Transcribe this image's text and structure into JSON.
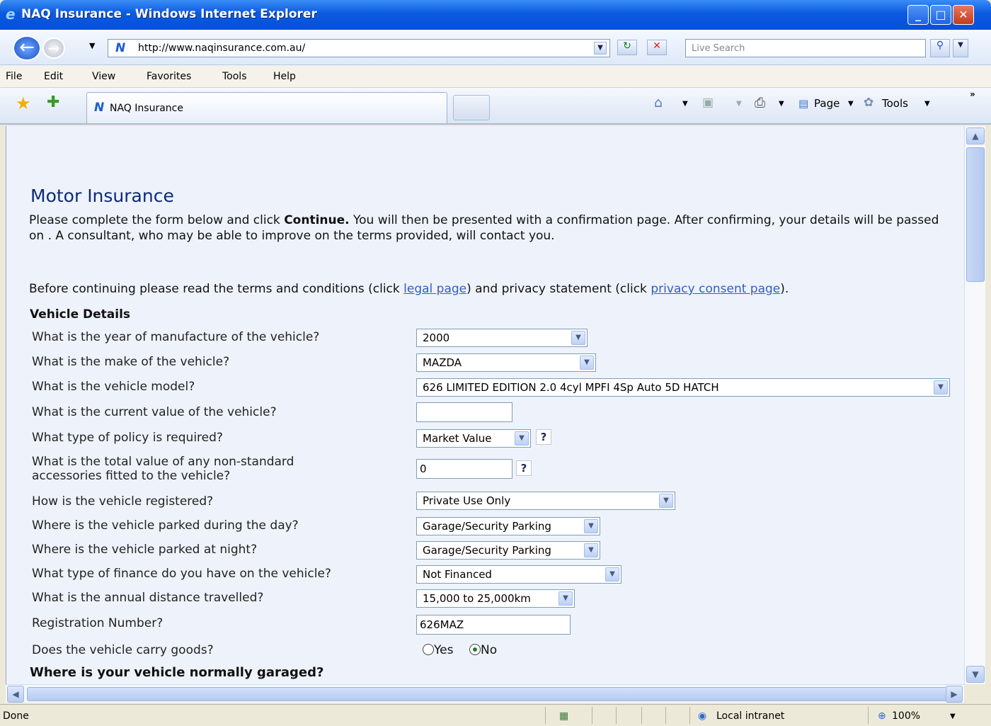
{
  "window": {
    "title": "NAQ Insurance - Windows Internet Explorer",
    "minimize": "_",
    "maximize": "□",
    "close": "✕"
  },
  "nav": {
    "url": "http://www.naqinsurance.com.au/",
    "search_placeholder": "Live Search"
  },
  "menu": [
    "File",
    "Edit",
    "View",
    "Favorites",
    "Tools",
    "Help"
  ],
  "tab": {
    "label": "NAQ Insurance"
  },
  "toolbar": {
    "page_label": "Page",
    "tools_label": "Tools"
  },
  "page": {
    "heading": "Motor Insurance",
    "intro_a": "Please complete the form below and click ",
    "intro_bold": "Continue.",
    "intro_b": " You will then be presented with a confirmation page. After confirming, your details will be passed on . A consultant, who may be able to improve on the terms provided, will contact you.",
    "terms_a": "Before continuing please read the terms and conditions (click ",
    "legal_link": "legal page",
    "terms_b": ") and privacy statement (click ",
    "privacy_link": "privacy consent page",
    "terms_c": ").",
    "section_vehicle": "Vehicle Details",
    "section_garage": "Where is your vehicle normally garaged?"
  },
  "form": {
    "q_year": "What is the year of manufacture of the vehicle?",
    "v_year": "2000",
    "q_make": "What is the make of the vehicle?",
    "v_make": "MAZDA",
    "q_model": "What is the vehicle model?",
    "v_model": "626 LIMITED EDITION 2.0 4cyl MPFI 4Sp Auto 5D HATCH",
    "q_value": "What is the current value of the vehicle?",
    "v_value": "",
    "q_policy": "What type of policy is required?",
    "v_policy": "Market Value",
    "q_accessories": "What is the total value of any non-standard accessories fitted to the vehicle?",
    "v_accessories": "0",
    "q_registered": "How is the vehicle registered?",
    "v_registered": "Private Use Only",
    "q_day": "Where is the vehicle parked during the day?",
    "v_day": "Garage/Security Parking",
    "q_night": "Where is the vehicle parked at night?",
    "v_night": "Garage/Security Parking",
    "q_finance": "What type of finance do you have on the vehicle?",
    "v_finance": "Not Financed",
    "q_distance": "What is the annual distance travelled?",
    "v_distance": "15,000 to 25,000km",
    "q_rego": "Registration Number?",
    "v_rego": "626MAZ",
    "q_goods": "Does the vehicle carry goods?",
    "opt_yes": "Yes",
    "opt_no": "No",
    "help": "?"
  },
  "status": {
    "left": "Done",
    "zone": "Local intranet",
    "zoom": "100%"
  }
}
